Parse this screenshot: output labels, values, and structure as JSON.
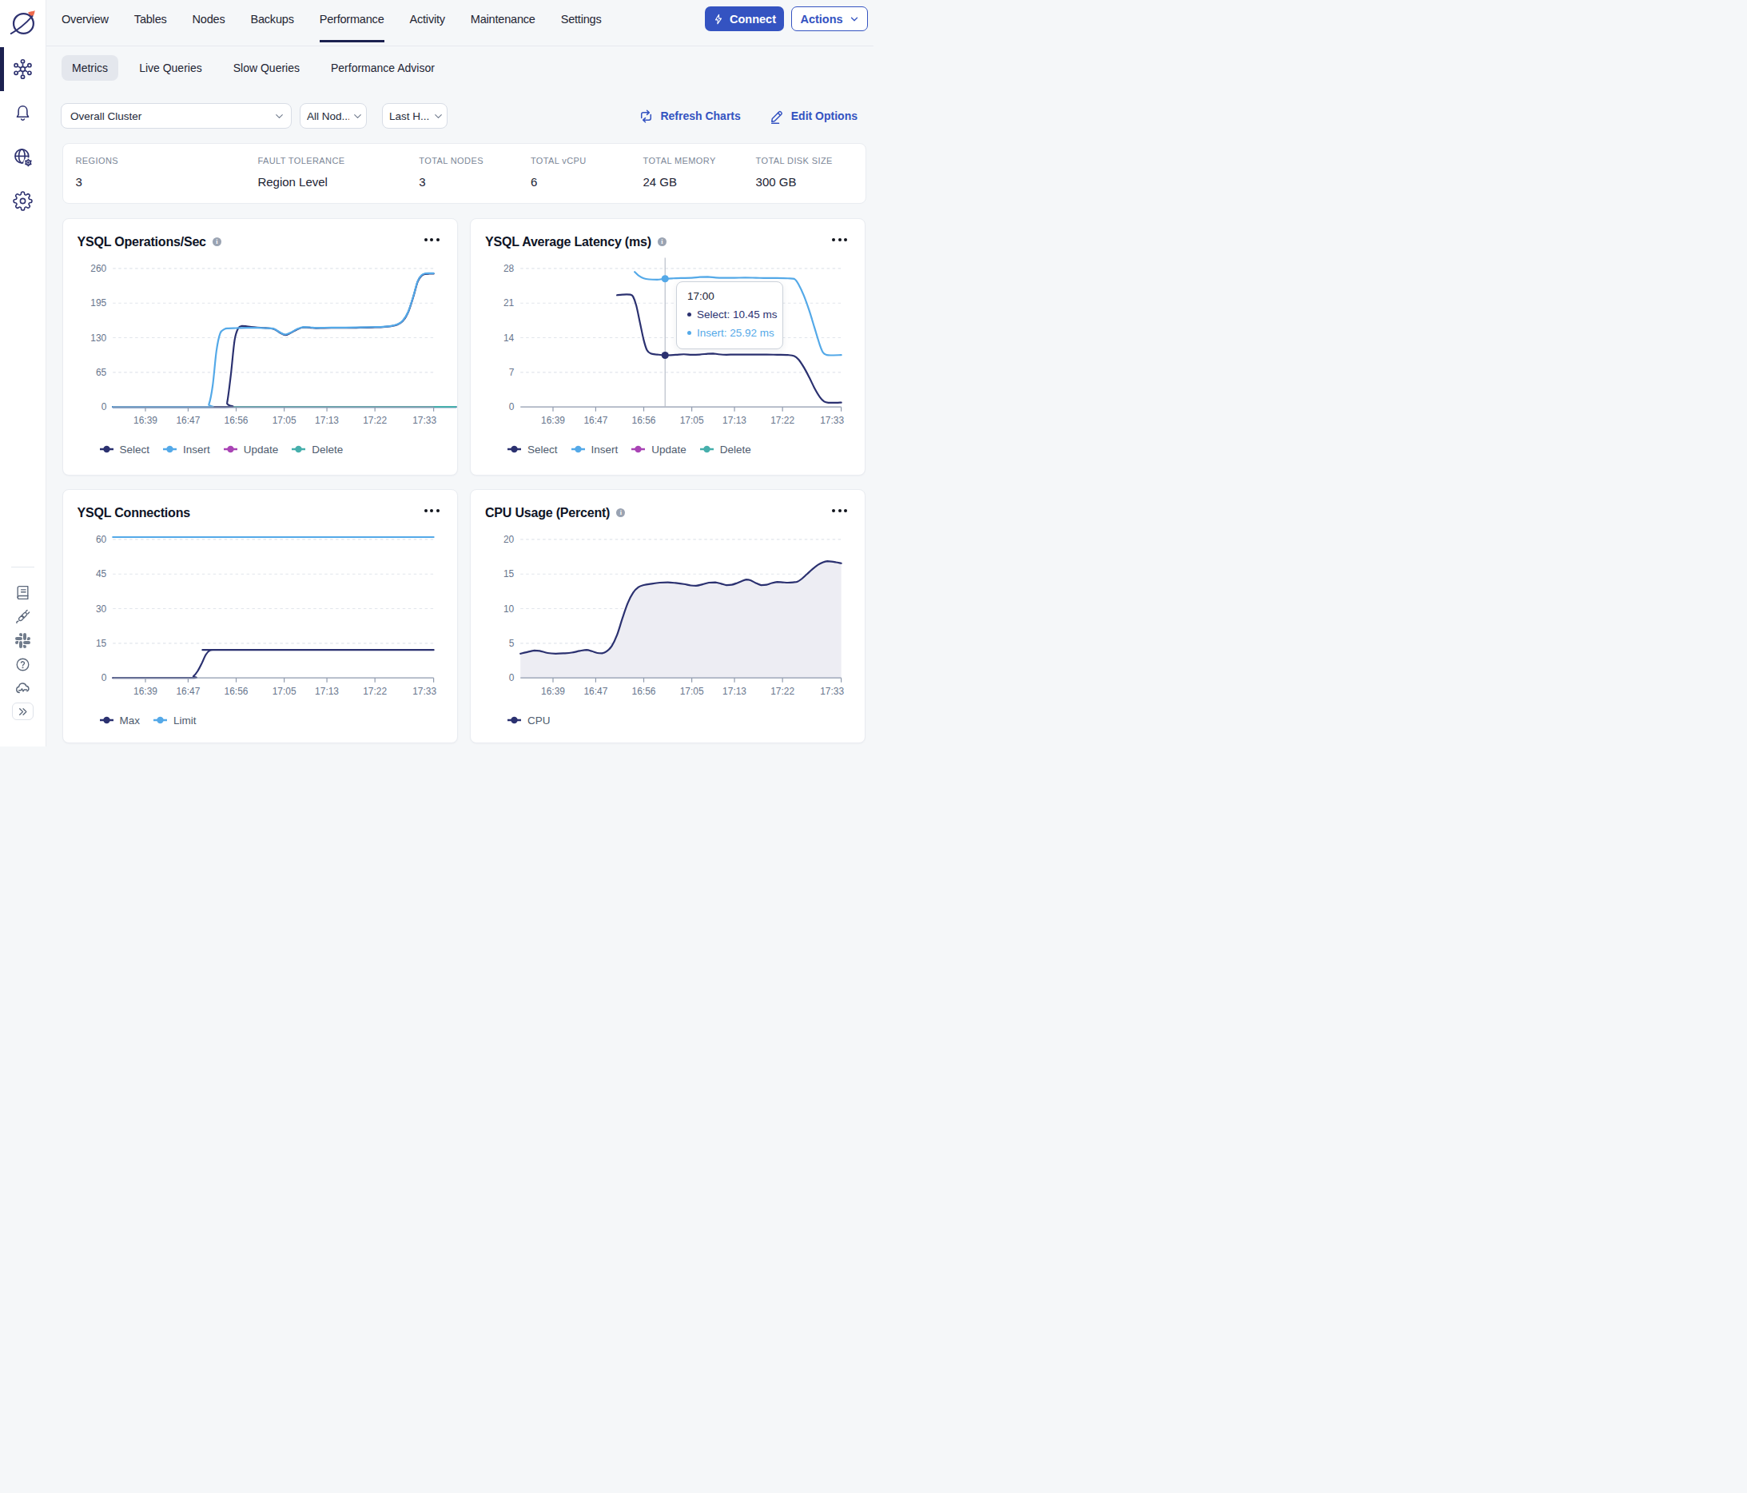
{
  "nav": {
    "items": [
      "Overview",
      "Tables",
      "Nodes",
      "Backups",
      "Performance",
      "Activity",
      "Maintenance",
      "Settings"
    ],
    "active": "Performance",
    "connect_label": "Connect",
    "actions_label": "Actions"
  },
  "tabs": {
    "items": [
      "Metrics",
      "Live Queries",
      "Slow Queries",
      "Performance Advisor"
    ],
    "active": "Metrics"
  },
  "filters": {
    "cluster_value": "Overall Cluster",
    "nodes_value": "All Nod...",
    "range_value": "Last H...",
    "refresh_label": "Refresh Charts",
    "edit_label": "Edit Options"
  },
  "summary": {
    "items": [
      {
        "label": "REGIONS",
        "value": "3"
      },
      {
        "label": "FAULT TOLERANCE",
        "value": "Region Level"
      },
      {
        "label": "TOTAL NODES",
        "value": "3"
      },
      {
        "label": "TOTAL vCPU",
        "value": "6"
      },
      {
        "label": "TOTAL MEMORY",
        "value": "24 GB"
      },
      {
        "label": "TOTAL DISK SIZE",
        "value": "300 GB"
      }
    ]
  },
  "colors": {
    "accent": "#3453c1",
    "select_navy": "#2b3170",
    "insert_blue": "#54a9e8",
    "update_purple": "#a944b5",
    "delete_teal": "#46afac",
    "axis": "#8e99ad",
    "grid": "#e1e5eb",
    "tick_text": "#67758d",
    "cpu_fill": "#ededf3"
  },
  "chart_data": [
    {
      "type": "line",
      "title": "YSQL Operations/Sec",
      "info_icon": true,
      "ylim": [
        0,
        260
      ],
      "y_ticks": [
        0,
        65,
        130,
        195,
        260
      ],
      "x_tick_labels": [
        "16:39",
        "16:47",
        "16:56",
        "17:05",
        "17:13",
        "17:22",
        "17:33"
      ],
      "x_tick_minutes": [
        39,
        47,
        56,
        65,
        73,
        82,
        93
      ],
      "x_domain_minutes": [
        32.9,
        93
      ],
      "legend": [
        "Select",
        "Insert",
        "Update",
        "Delete"
      ],
      "series": [
        {
          "name": "Update",
          "color": "#a944b5",
          "points": [
            [
              32.9,
              0
            ],
            [
              97.2,
              0
            ]
          ]
        },
        {
          "name": "Delete",
          "color": "#46afac",
          "points": [
            [
              32.9,
              0
            ],
            [
              97.2,
              0
            ]
          ]
        },
        {
          "name": "Select",
          "color": "#2b3170",
          "points": [
            [
              32.9,
              0
            ],
            [
              53.7,
              0
            ],
            [
              54.3,
              8
            ],
            [
              55,
              60
            ],
            [
              55.7,
              125
            ],
            [
              56.4,
              148
            ],
            [
              57.1,
              152
            ],
            [
              57.8,
              151.5
            ],
            [
              58.8,
              150
            ],
            [
              60,
              149
            ],
            [
              61.5,
              148.3
            ],
            [
              63,
              146.5
            ],
            [
              64.2,
              139.5
            ],
            [
              65.2,
              135
            ],
            [
              66.2,
              139
            ],
            [
              67.4,
              145.5
            ],
            [
              68.6,
              149.5
            ],
            [
              69.8,
              149
            ],
            [
              71,
              147.8
            ],
            [
              72.5,
              148.3
            ],
            [
              74.5,
              148.5
            ],
            [
              76.5,
              148.5
            ],
            [
              78.5,
              148.7
            ],
            [
              80.5,
              149.1
            ],
            [
              82,
              149.5
            ],
            [
              83.5,
              150
            ],
            [
              85,
              151.5
            ],
            [
              86.2,
              154.5
            ],
            [
              87.2,
              161
            ],
            [
              88.2,
              177
            ],
            [
              89.2,
              207
            ],
            [
              90,
              235
            ],
            [
              90.7,
              246
            ],
            [
              91.4,
              249.5
            ],
            [
              92.2,
              250
            ],
            [
              93,
              250
            ]
          ]
        },
        {
          "name": "Insert",
          "color": "#54a9e8",
          "points": [
            [
              32.9,
              0
            ],
            [
              50.2,
              0
            ],
            [
              50.9,
              5
            ],
            [
              51.6,
              40
            ],
            [
              52.3,
              105
            ],
            [
              53,
              138
            ],
            [
              53.8,
              146
            ],
            [
              54.5,
              147.5
            ],
            [
              56,
              148
            ],
            [
              58,
              148.5
            ],
            [
              60,
              148.5
            ],
            [
              61.5,
              148
            ],
            [
              63,
              147
            ],
            [
              64.2,
              140
            ],
            [
              65.2,
              136
            ],
            [
              66.2,
              139.5
            ],
            [
              67.4,
              146
            ],
            [
              68.6,
              150
            ],
            [
              69.8,
              149.5
            ],
            [
              71,
              148.3
            ],
            [
              72.5,
              148.8
            ],
            [
              74.5,
              149
            ],
            [
              76.5,
              149
            ],
            [
              78.5,
              149.2
            ],
            [
              80.5,
              149.6
            ],
            [
              82,
              150
            ],
            [
              83.5,
              150.5
            ],
            [
              85,
              152
            ],
            [
              86.2,
              155
            ],
            [
              87.2,
              162
            ],
            [
              88.2,
              178
            ],
            [
              89.2,
              208
            ],
            [
              90,
              236
            ],
            [
              90.7,
              247
            ],
            [
              91.4,
              250.5
            ],
            [
              92.2,
              251
            ],
            [
              93,
              251
            ]
          ]
        }
      ]
    },
    {
      "type": "line",
      "title": "YSQL Average Latency (ms)",
      "info_icon": true,
      "ylim": [
        0,
        28
      ],
      "y_ticks": [
        0,
        7,
        14,
        21,
        28
      ],
      "x_tick_labels": [
        "16:39",
        "16:47",
        "16:56",
        "17:05",
        "17:13",
        "17:22",
        "17:33"
      ],
      "x_tick_minutes": [
        39,
        47,
        56,
        65,
        73,
        82,
        93
      ],
      "x_domain_minutes": [
        32.9,
        93
      ],
      "legend": [
        "Select",
        "Insert",
        "Update",
        "Delete"
      ],
      "series": [
        {
          "name": "Insert",
          "color": "#54a9e8",
          "points": [
            [
              54.3,
              27.3
            ],
            [
              55,
              26.6
            ],
            [
              56,
              26.0
            ],
            [
              57,
              25.8
            ],
            [
              58.5,
              25.75
            ],
            [
              60,
              25.92
            ],
            [
              61.5,
              26.0
            ],
            [
              63,
              26.05
            ],
            [
              65,
              26.1
            ],
            [
              66.5,
              26.25
            ],
            [
              68,
              26.3
            ],
            [
              69.5,
              26.15
            ],
            [
              71,
              26.1
            ],
            [
              73,
              26.1
            ],
            [
              75,
              26.15
            ],
            [
              77,
              26.1
            ],
            [
              79,
              26.05
            ],
            [
              81,
              26.05
            ],
            [
              83,
              26.0
            ],
            [
              84.2,
              25.9
            ],
            [
              85,
              24.8
            ],
            [
              86,
              22.5
            ],
            [
              87,
              19.5
            ],
            [
              88,
              16
            ],
            [
              89,
              12.5
            ],
            [
              89.6,
              11
            ],
            [
              90.3,
              10.5
            ],
            [
              91,
              10.45
            ],
            [
              93,
              10.5
            ]
          ]
        },
        {
          "name": "Select",
          "color": "#2b3170",
          "points": [
            [
              51.0,
              22.6
            ],
            [
              52,
              22.7
            ],
            [
              52.8,
              22.75
            ],
            [
              53.5,
              22.7
            ],
            [
              54,
              22.3
            ],
            [
              54.6,
              20.5
            ],
            [
              55.3,
              17
            ],
            [
              56,
              13.5
            ],
            [
              56.6,
              11.5
            ],
            [
              57.3,
              10.8
            ],
            [
              58.5,
              10.6
            ],
            [
              60,
              10.45
            ],
            [
              62,
              10.55
            ],
            [
              63.5,
              10.65
            ],
            [
              65,
              10.55
            ],
            [
              66.5,
              10.6
            ],
            [
              68,
              10.75
            ],
            [
              69,
              10.8
            ],
            [
              70,
              10.65
            ],
            [
              71.5,
              10.55
            ],
            [
              73,
              10.6
            ],
            [
              75,
              10.6
            ],
            [
              77,
              10.6
            ],
            [
              79,
              10.6
            ],
            [
              81,
              10.55
            ],
            [
              83,
              10.5
            ],
            [
              84.2,
              10.3
            ],
            [
              85,
              9.6
            ],
            [
              86,
              8
            ],
            [
              87,
              6
            ],
            [
              88,
              3.8
            ],
            [
              89,
              2
            ],
            [
              89.8,
              1.1
            ],
            [
              90.6,
              0.85
            ],
            [
              92,
              0.85
            ],
            [
              93,
              0.9
            ]
          ]
        }
      ],
      "cursor": {
        "minutes": 60,
        "points": [
          {
            "series": "Insert",
            "value": 25.92,
            "color": "#54a9e8"
          },
          {
            "series": "Select",
            "value": 10.45,
            "color": "#2b3170"
          }
        ],
        "tooltip": {
          "time": "17:00",
          "rows": [
            {
              "label": "Select",
              "value": "10.45 ms",
              "color": "#2b3170"
            },
            {
              "label": "Insert",
              "value": "25.92 ms",
              "color": "#54a9e8"
            }
          ]
        }
      }
    },
    {
      "type": "line",
      "title": "YSQL Connections",
      "info_icon": false,
      "ylim": [
        0,
        60
      ],
      "y_ticks": [
        0,
        15,
        30,
        45,
        60
      ],
      "x_tick_labels": [
        "16:39",
        "16:47",
        "16:56",
        "17:05",
        "17:13",
        "17:22",
        "17:33"
      ],
      "x_tick_minutes": [
        39,
        47,
        56,
        65,
        73,
        82,
        93
      ],
      "x_domain_minutes": [
        32.9,
        93
      ],
      "legend": [
        "Max",
        "Limit"
      ],
      "series": [
        {
          "name": "Limit",
          "color": "#54a9e8",
          "points": [
            [
              32.9,
              61
            ],
            [
              93,
              61
            ]
          ]
        },
        {
          "name": "Max",
          "color": "#2b3170",
          "points": [
            [
              32.9,
              0
            ],
            [
              47.3,
              0
            ],
            [
              48,
              0.7
            ],
            [
              48.8,
              3
            ],
            [
              49.6,
              6.5
            ],
            [
              50.3,
              10
            ],
            [
              51,
              11.8
            ],
            [
              51.8,
              12.1
            ],
            [
              53,
              12.1
            ],
            [
              93,
              12.1
            ]
          ]
        }
      ]
    },
    {
      "type": "area",
      "title": "CPU Usage (Percent)",
      "info_icon": true,
      "ylim": [
        0,
        20
      ],
      "y_ticks": [
        0,
        5,
        10,
        15,
        20
      ],
      "x_tick_labels": [
        "16:39",
        "16:47",
        "16:56",
        "17:05",
        "17:13",
        "17:22",
        "17:33"
      ],
      "x_tick_minutes": [
        39,
        47,
        56,
        65,
        73,
        82,
        93
      ],
      "x_domain_minutes": [
        32.9,
        93
      ],
      "legend": [
        "CPU"
      ],
      "series": [
        {
          "name": "CPU",
          "color": "#2b3170",
          "fill": "#ededf3",
          "points": [
            [
              32.9,
              3.5
            ],
            [
              34,
              3.7
            ],
            [
              35.5,
              3.95
            ],
            [
              36.5,
              3.9
            ],
            [
              38,
              3.6
            ],
            [
              39.5,
              3.5
            ],
            [
              41,
              3.55
            ],
            [
              42.5,
              3.65
            ],
            [
              44,
              3.9
            ],
            [
              45.3,
              4.05
            ],
            [
              46.3,
              3.85
            ],
            [
              47.3,
              3.6
            ],
            [
              48.2,
              3.55
            ],
            [
              49,
              3.8
            ],
            [
              50,
              4.6
            ],
            [
              51,
              6.2
            ],
            [
              52,
              8.6
            ],
            [
              53,
              10.8
            ],
            [
              54,
              12.3
            ],
            [
              55,
              13.1
            ],
            [
              56,
              13.4
            ],
            [
              57.5,
              13.6
            ],
            [
              59,
              13.75
            ],
            [
              60.5,
              13.8
            ],
            [
              62,
              13.7
            ],
            [
              63.5,
              13.55
            ],
            [
              64.8,
              13.35
            ],
            [
              65.8,
              13.3
            ],
            [
              67,
              13.5
            ],
            [
              68.2,
              13.75
            ],
            [
              69.4,
              13.8
            ],
            [
              70.5,
              13.6
            ],
            [
              71.5,
              13.4
            ],
            [
              72.5,
              13.45
            ],
            [
              73.5,
              13.7
            ],
            [
              74.3,
              13.95
            ],
            [
              75.2,
              14.2
            ],
            [
              76,
              14.1
            ],
            [
              77,
              13.7
            ],
            [
              78,
              13.4
            ],
            [
              79,
              13.45
            ],
            [
              80,
              13.7
            ],
            [
              81,
              13.85
            ],
            [
              82,
              13.8
            ],
            [
              83,
              13.75
            ],
            [
              84,
              13.8
            ],
            [
              84.8,
              13.9
            ],
            [
              85.6,
              14.3
            ],
            [
              86.6,
              15
            ],
            [
              87.6,
              15.7
            ],
            [
              88.6,
              16.3
            ],
            [
              89.6,
              16.7
            ],
            [
              90.4,
              16.85
            ],
            [
              91.2,
              16.8
            ],
            [
              92,
              16.7
            ],
            [
              93,
              16.55
            ]
          ]
        }
      ]
    }
  ]
}
